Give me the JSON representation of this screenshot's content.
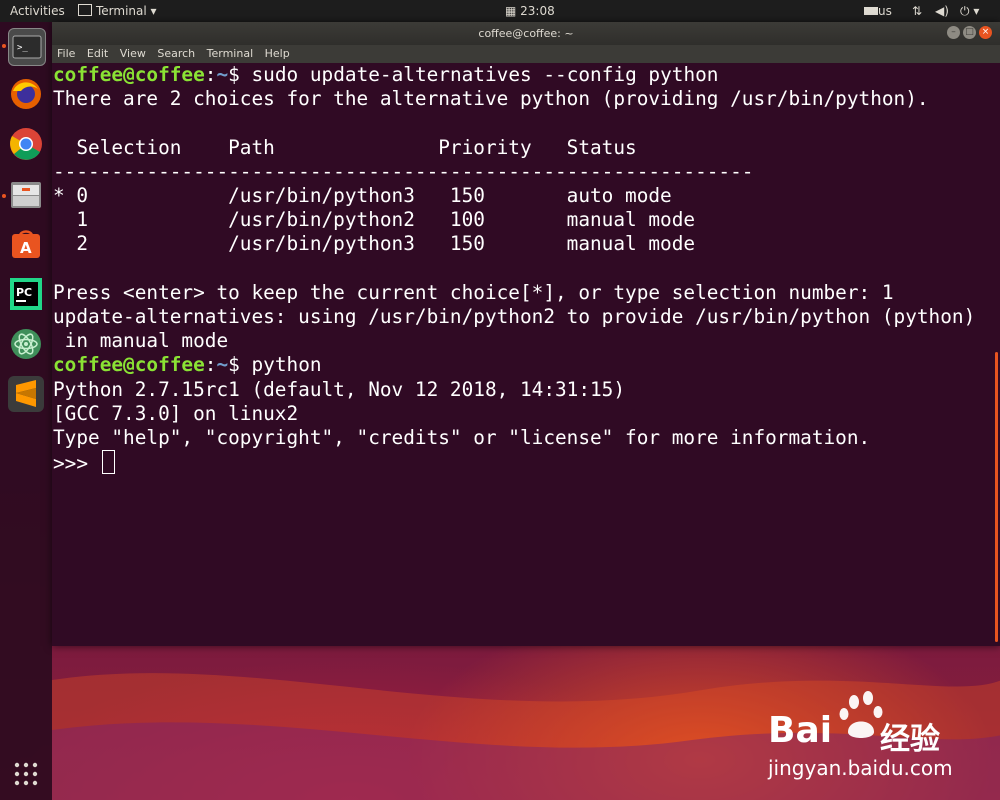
{
  "top_panel": {
    "activities": "Activities",
    "app_menu": "Terminal",
    "clock": "23:08",
    "keyboard_layout": "us"
  },
  "window": {
    "title": "coffee@coffee: ~",
    "menu": [
      "File",
      "Edit",
      "View",
      "Search",
      "Terminal",
      "Help"
    ]
  },
  "terminal": {
    "user_host": "coffee@coffee",
    "sep": ":",
    "path": "~",
    "dollar": "$ ",
    "cmd1": "sudo update-alternatives --config python",
    "line_choices": "There are 2 choices for the alternative python (providing /usr/bin/python).",
    "table_header": "  Selection    Path              Priority   Status",
    "table_rule": "------------------------------------------------------------",
    "rows": [
      "* 0            /usr/bin/python3   150       auto mode",
      "  1            /usr/bin/python2   100       manual mode",
      "  2            /usr/bin/python3   150       manual mode"
    ],
    "press_enter": "Press <enter> to keep the current choice[*], or type selection number: 1",
    "using_line": "update-alternatives: using /usr/bin/python2 to provide /usr/bin/python (python)",
    "manual_mode": " in manual mode",
    "cmd2": "python",
    "py_version": "Python 2.7.15rc1 (default, Nov 12 2018, 14:31:15)",
    "gcc": "[GCC 7.3.0] on linux2",
    "type_help": "Type \"help\", \"copyright\", \"credits\" or \"license\" for more information.",
    "repl_prompt": ">>> "
  },
  "dock": {
    "icons": [
      "terminal-icon",
      "firefox-icon",
      "chrome-icon",
      "files-icon",
      "software-icon",
      "pycharm-icon",
      "atom-icon",
      "sublime-icon",
      "apps-grid-icon"
    ]
  },
  "watermark": {
    "brand": "Bai",
    "brand_cn": "经验",
    "url": "jingyan.baidu.com"
  },
  "colors": {
    "terminal_bg": "#300a24",
    "prompt_user": "#8ae234",
    "prompt_path": "#729fcf",
    "accent": "#e95420"
  }
}
